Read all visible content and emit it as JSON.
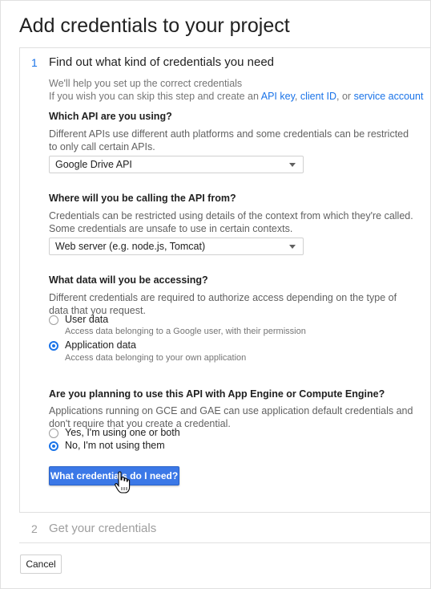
{
  "header": {
    "title": "Add credentials to your project"
  },
  "step1": {
    "number": "1",
    "title": "Find out what kind of credentials you need",
    "intro": {
      "line1": "We'll help you set up the correct credentials",
      "line2_prefix": "If you wish you can skip this step and create an",
      "link_api_key": "API key",
      "comma": ",",
      "link_client_id": "client ID",
      "or": ", or",
      "link_service_account": "service account"
    },
    "api_question": {
      "label": "Which API are you using?",
      "desc1": "Different APIs use different auth platforms and some credentials can be restricted",
      "desc2": "to only call certain APIs.",
      "selected": "Google Drive API"
    },
    "where_question": {
      "label": "Where will you be calling the API from?",
      "desc1": "Credentials can be restricted using details of the context from which they're called.",
      "desc2": "Some credentials are unsafe to use in certain contexts.",
      "selected": "Web server (e.g. node.js, Tomcat)"
    },
    "data_question": {
      "label": "What data will you be accessing?",
      "desc1": "Different credentials are required to authorize access depending on the type of",
      "desc2": "data that you request.",
      "options": [
        {
          "label": "User data",
          "desc": "Access data belonging to a Google user, with their permission",
          "selected": false
        },
        {
          "label": "Application data",
          "desc": "Access data belonging to your own application",
          "selected": true
        }
      ]
    },
    "engine_question": {
      "label": "Are you planning to use this API with App Engine or Compute Engine?",
      "desc1": "Applications running on GCE and GAE can use application default credentials and",
      "desc2": "don't require that you create a credential.",
      "options": [
        {
          "label": "Yes, I'm using one or both",
          "selected": false
        },
        {
          "label": "No, I'm not using them",
          "selected": true
        }
      ]
    },
    "submit_label": "What credentials do I need?"
  },
  "step2": {
    "number": "2",
    "title": "Get your credentials"
  },
  "footer": {
    "cancel_label": "Cancel"
  },
  "colors": {
    "accent": "#1a73e8",
    "button": "#3b78e7"
  },
  "icons": {
    "select_caret": "caret-down-icon",
    "pointer": "hand-pointer-icon"
  }
}
